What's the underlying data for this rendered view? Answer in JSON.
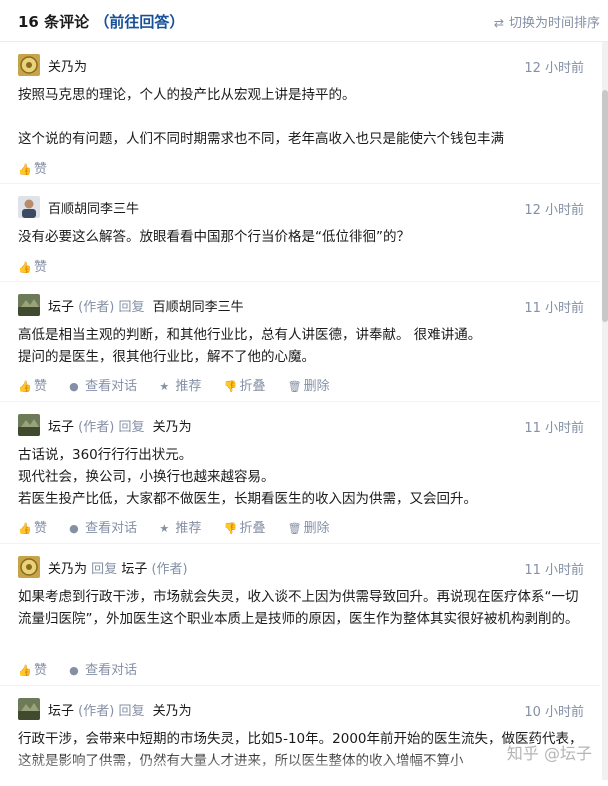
{
  "header": {
    "count_title": "16 条评论",
    "paren_open": "（",
    "go_answer_link": "前往回答",
    "paren_close": "）",
    "sort_label": "切换为时间排序"
  },
  "comments": [
    {
      "author": "关乃为",
      "time": "12 小时前",
      "body": "按照马克思的理论，个人的投产比从宏观上讲是持平的。\n\n这个说的有问题，人们不同时期需求也不同，老年高收入也只是能使六个钱包丰满",
      "like_label": "赞"
    },
    {
      "author": "百顺胡同李三牛",
      "time": "12 小时前",
      "body": "没有必要这么解答。放眼看看中国那个行当价格是“低位徘徊”的？",
      "like_label": "赞"
    },
    {
      "author": "坛子",
      "author_tag": "(作者)",
      "reply_word": "回复",
      "reply_to": "百顺胡同李三牛",
      "time": "11 小时前",
      "body": "高低是相当主观的判断，和其他行业比，总有人讲医德，讲奉献。 很难讲通。\n提问的是医生，很其他行业比，解不了他的心魔。",
      "like_label": "赞",
      "view_label": "查看对话",
      "recommend_label": "推荐",
      "collapse_label": "折叠",
      "delete_label": "删除"
    },
    {
      "author": "坛子",
      "author_tag": "(作者)",
      "reply_word": "回复",
      "reply_to": "关乃为",
      "time": "11 小时前",
      "body": "古话说，360行行行出状元。\n现代社会，换公司，小换行也越来越容易。\n若医生投产比低，大家都不做医生，长期看医生的收入因为供需，又会回升。",
      "like_label": "赞",
      "view_label": "查看对话",
      "recommend_label": "推荐",
      "collapse_label": "折叠",
      "delete_label": "删除"
    },
    {
      "author": "关乃为",
      "reply_word": "回复",
      "reply_to": "坛子",
      "reply_to_tag": "(作者)",
      "time": "11 小时前",
      "body": "如果考虑到行政干涉，市场就会失灵，收入谈不上因为供需导致回升。再说现在医疗体系“一切流量归医院”，外加医生这个职业本质上是技师的原因，医生作为整体其实很好被机构剥削的。",
      "like_label": "赞",
      "view_label": "查看对话"
    },
    {
      "author": "坛子",
      "author_tag": "(作者)",
      "reply_word": "回复",
      "reply_to": "关乃为",
      "time": "10 小时前",
      "body": "行政干涉，会带来中短期的市场失灵，比如5-10年。2000年前开始的医生流失，做医药代表，这就是影响了供需，仍然有大量人才进来，所以医生整体的收入增幅不算小"
    }
  ],
  "watermark": "知乎 @坛子",
  "colors": {
    "link": "#175199",
    "muted": "#8590a6",
    "divider": "#f0f2f7"
  }
}
